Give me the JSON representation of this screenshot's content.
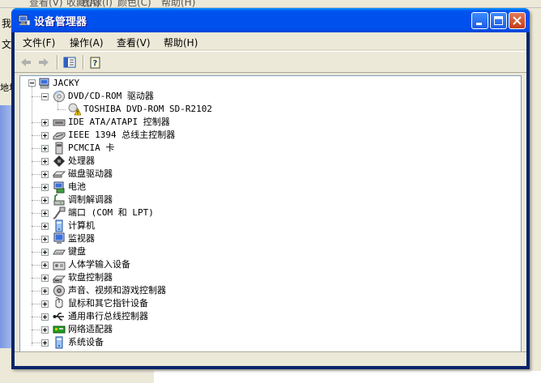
{
  "background": {
    "menu_fragments": [
      "查看(V)",
      "收藏(A)",
      "图像(I)",
      "颜色(C)",
      "帮助(H)"
    ],
    "left_fragments": [
      "我",
      "文",
      "地址"
    ]
  },
  "window": {
    "title": "设备管理器"
  },
  "menu": {
    "items": [
      "文件(F)",
      "操作(A)",
      "查看(V)",
      "帮助(H)"
    ]
  },
  "toolbar": {
    "buttons": [
      "back-icon",
      "forward-icon",
      "properties-icon",
      "help-icon"
    ]
  },
  "tree": {
    "root": "JACKY",
    "items": [
      {
        "label": "DVD/CD-ROM 驱动器",
        "icon": "cdrom-icon",
        "expanded": true
      },
      {
        "label": "TOSHIBA DVD-ROM SD-R2102",
        "icon": "warning-device-icon",
        "child": true
      },
      {
        "label": "IDE ATA/ATAPI 控制器",
        "icon": "ide-controller-icon"
      },
      {
        "label": "IEEE 1394 总线主控制器",
        "icon": "ieee1394-icon"
      },
      {
        "label": "PCMCIA 卡",
        "icon": "pcmcia-icon"
      },
      {
        "label": "处理器",
        "icon": "processor-icon"
      },
      {
        "label": "磁盘驱动器",
        "icon": "disk-drive-icon"
      },
      {
        "label": "电池",
        "icon": "battery-icon"
      },
      {
        "label": "调制解调器",
        "icon": "modem-icon"
      },
      {
        "label": "端口 (COM 和 LPT)",
        "icon": "port-icon"
      },
      {
        "label": "计算机",
        "icon": "computer-icon"
      },
      {
        "label": "监视器",
        "icon": "monitor-icon"
      },
      {
        "label": "键盘",
        "icon": "keyboard-icon"
      },
      {
        "label": "人体学输入设备",
        "icon": "hid-icon"
      },
      {
        "label": "软盘控制器",
        "icon": "floppy-icon"
      },
      {
        "label": "声音、视频和游戏控制器",
        "icon": "sound-icon"
      },
      {
        "label": "鼠标和其它指针设备",
        "icon": "mouse-icon"
      },
      {
        "label": "通用串行总线控制器",
        "icon": "usb-icon"
      },
      {
        "label": "网络适配器",
        "icon": "network-icon"
      },
      {
        "label": "系统设备",
        "icon": "system-device-icon"
      }
    ]
  },
  "colors": {
    "title_blue": "#0050ee",
    "chrome": "#ece9d8",
    "border": "#7f9db9"
  }
}
